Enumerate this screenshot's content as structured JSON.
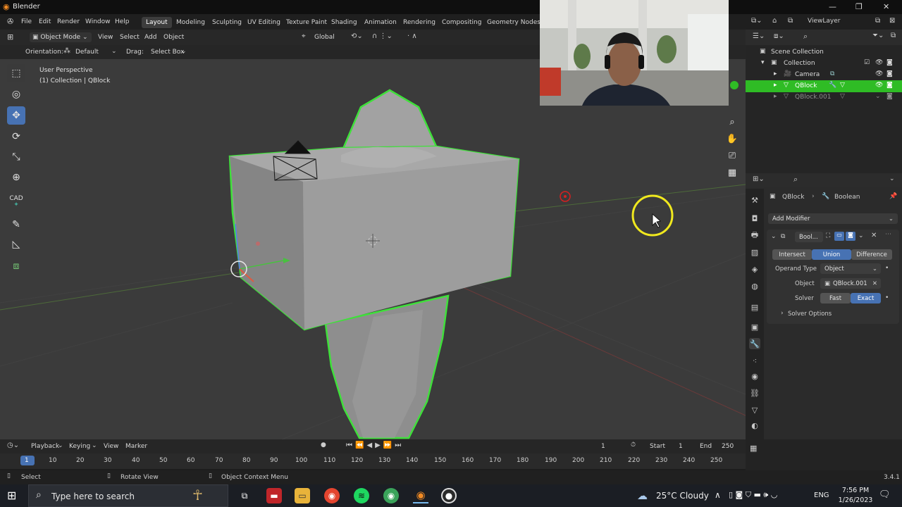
{
  "window": {
    "title": "Blender"
  },
  "menu": {
    "items": [
      "File",
      "Edit",
      "Render",
      "Window",
      "Help"
    ]
  },
  "workspaces": [
    "Layout",
    "Modeling",
    "Sculpting",
    "UV Editing",
    "Texture Paint",
    "Shading",
    "Animation",
    "Rendering",
    "Compositing",
    "Geometry Nodes"
  ],
  "viewport_header": {
    "mode": "Object Mode",
    "menus": [
      "View",
      "Select",
      "Add",
      "Object"
    ],
    "transform": "Global"
  },
  "tool_settings": {
    "orientation_label": "Orientation:",
    "orientation_value": "Default",
    "drag_label": "Drag:",
    "drag_value": "Select Box"
  },
  "viewport": {
    "perspective": "User Perspective",
    "collection_info": "(1) Collection | QBlock"
  },
  "tools": {
    "cad_label": "CAD"
  },
  "outliner": {
    "view_layer": "ViewLayer",
    "rows": [
      {
        "label": "Scene Collection"
      },
      {
        "label": "Collection"
      },
      {
        "label": "Camera"
      },
      {
        "label": "QBlock"
      },
      {
        "label": "QBlock.001"
      }
    ]
  },
  "properties": {
    "breadcrumb_object": "QBlock",
    "breadcrumb_modifier": "Boolean",
    "add_modifier": "Add Modifier",
    "modifier_name": "Bool...",
    "operations": [
      "Intersect",
      "Union",
      "Difference"
    ],
    "active_operation": "Union",
    "operand_type_label": "Operand Type",
    "operand_type_value": "Object",
    "object_label": "Object",
    "object_value": "QBlock.001",
    "solver_label": "Solver",
    "solver_options": [
      "Fast",
      "Exact"
    ],
    "active_solver": "Exact",
    "solver_options_panel": "Solver Options"
  },
  "timeline": {
    "menus": [
      "Playback",
      "Keying",
      "View",
      "Marker"
    ],
    "current_frame": "1",
    "start_label": "Start",
    "start_value": "1",
    "end_label": "End",
    "end_value": "250",
    "ticks": [
      "1",
      "10",
      "20",
      "30",
      "40",
      "50",
      "60",
      "70",
      "80",
      "90",
      "100",
      "110",
      "120",
      "130",
      "140",
      "150",
      "160",
      "170",
      "180",
      "190",
      "200",
      "210",
      "220",
      "230",
      "240",
      "250"
    ]
  },
  "statusbar": {
    "select": "Select",
    "rotate": "Rotate View",
    "context": "Object Context Menu",
    "version": "3.4.1"
  },
  "taskbar": {
    "search_placeholder": "Type here to search",
    "weather": "25°C  Cloudy",
    "language": "ENG",
    "time": "7:56 PM",
    "date": "1/26/2023"
  },
  "colors": {
    "accent": "#4772b3",
    "selection": "#2fbc25",
    "outline": "#3fe03a"
  }
}
